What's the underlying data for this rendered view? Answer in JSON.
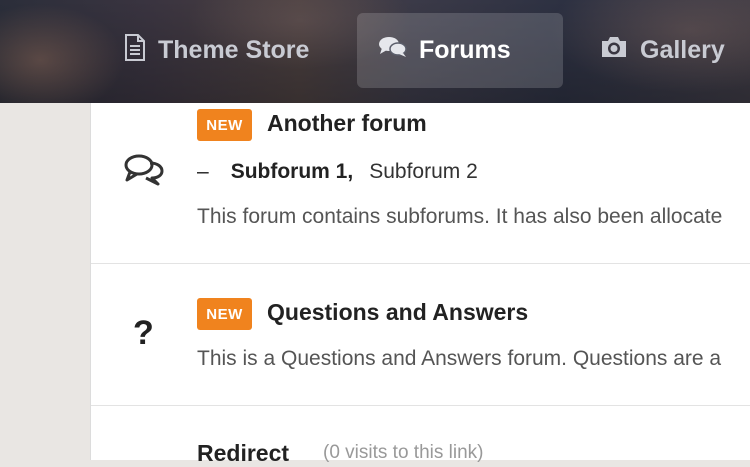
{
  "nav": {
    "tabs": [
      {
        "label": "Theme Store",
        "icon": "document-icon",
        "active": false
      },
      {
        "label": "Forums",
        "icon": "chat-bubbles-icon",
        "active": true
      },
      {
        "label": "Gallery",
        "icon": "camera-icon",
        "active": false
      }
    ]
  },
  "forums": [
    {
      "badge": "NEW",
      "title": "Another forum",
      "icon": "chat-bubbles-outline-icon",
      "subforums": [
        "Subforum 1,",
        "Subforum 2"
      ],
      "subforum_prefix": "–",
      "description": "This forum contains subforums. It has also been allocate"
    },
    {
      "badge": "NEW",
      "title": "Questions and Answers",
      "icon": "question-mark-icon",
      "icon_glyph": "?",
      "description": "This is a Questions and Answers forum. Questions are a"
    },
    {
      "title": "Redirect",
      "meta": "(0 visits to this link)"
    }
  ],
  "colors": {
    "badge": "#f0831e",
    "active_tab_bg": "rgba(255,255,255,0.16)",
    "page_bg": "#e9e6e3",
    "panel_bg": "#ffffff"
  }
}
